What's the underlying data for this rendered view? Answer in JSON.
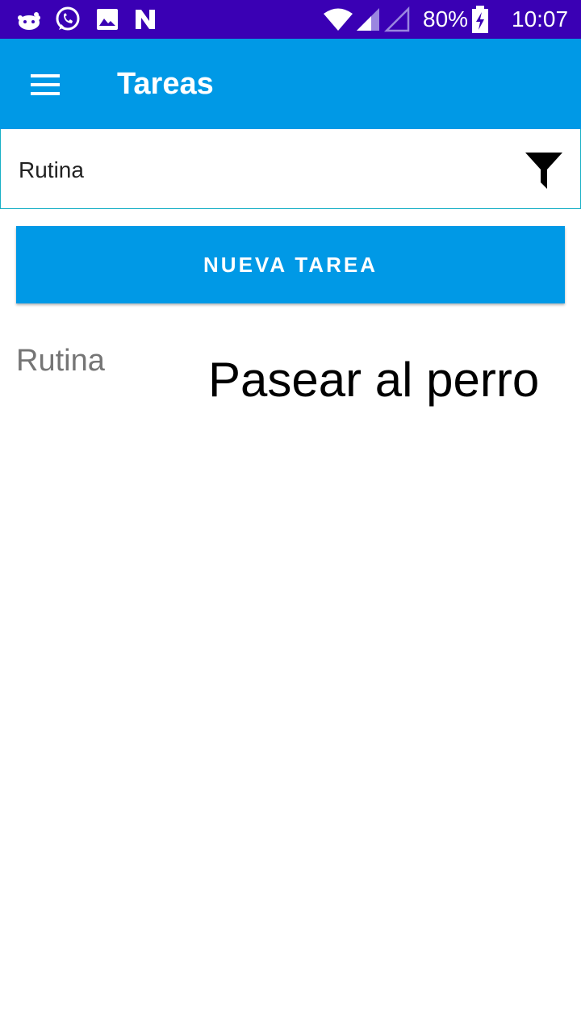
{
  "status_bar": {
    "icons_left": [
      "reddit-icon",
      "whatsapp-icon",
      "gallery-icon",
      "n-icon"
    ],
    "battery": "80%",
    "time": "10:07"
  },
  "app_bar": {
    "title": "Tareas",
    "menu_icon": "menu-icon"
  },
  "filter": {
    "value": "Rutina",
    "icon": "filter-icon"
  },
  "new_task_button": {
    "label": "NUEVA TAREA"
  },
  "tasks": [
    {
      "category": "Rutina",
      "name": "Pasear al perro"
    }
  ],
  "colors": {
    "status_bar": "#3a00b4",
    "primary": "#0099e6",
    "filter_border": "#19b0c6"
  }
}
